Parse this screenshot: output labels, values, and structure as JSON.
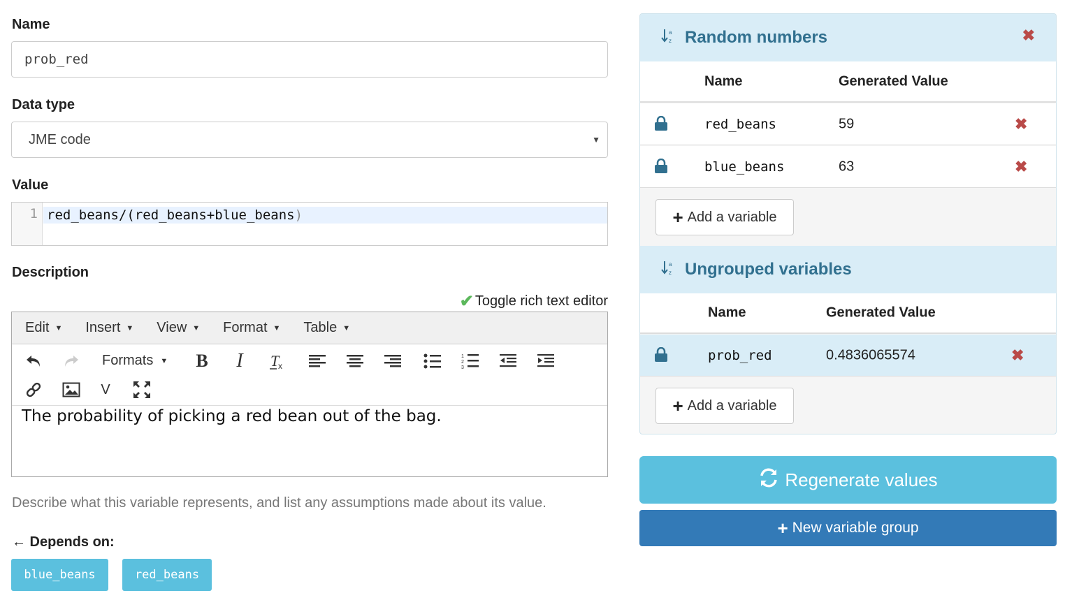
{
  "form": {
    "name_label": "Name",
    "name_value": "prob_red",
    "datatype_label": "Data type",
    "datatype_value": "JME code",
    "value_label": "Value",
    "value_line_number": "1",
    "value_code_main": "red_beans/(red_beans+blue_beans",
    "value_code_close": ")",
    "description_label": "Description",
    "toggle_rte_label": "Toggle rich text editor",
    "editor": {
      "menus": [
        "Edit",
        "Insert",
        "View",
        "Format",
        "Table"
      ],
      "formats_label": "Formats",
      "variable_button_label": "V",
      "content": "The probability of picking a red bean out of the bag."
    },
    "help_text": "Describe what this variable represents, and list any assumptions made about its value.",
    "depends_label": "← Depends on:",
    "depends_on": [
      "blue_beans",
      "red_beans"
    ]
  },
  "groups": [
    {
      "title": "Random numbers",
      "col_name": "Name",
      "col_value": "Generated Value",
      "rows": [
        {
          "name": "red_beans",
          "value": "59"
        },
        {
          "name": "blue_beans",
          "value": "63"
        }
      ],
      "add_label": "Add a variable"
    },
    {
      "title": "Ungrouped variables",
      "col_name": "Name",
      "col_value": "Generated Value",
      "rows": [
        {
          "name": "prob_red",
          "value": "0.4836065574"
        }
      ],
      "add_label": "Add a variable"
    }
  ],
  "actions": {
    "regenerate_label": "Regenerate values",
    "new_group_label": "New variable group"
  },
  "colors": {
    "info": "#5bc0de",
    "primary": "#337ab7",
    "panel_head": "#d9edf7",
    "danger": "#b94a48",
    "success": "#5cb85c"
  }
}
